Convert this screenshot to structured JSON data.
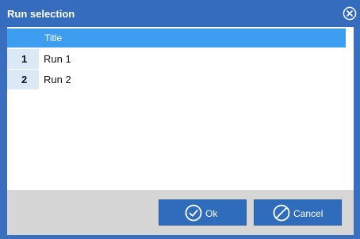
{
  "dialog": {
    "title": "Run selection"
  },
  "grid": {
    "columns": [
      "Title"
    ],
    "rows": [
      {
        "num": "1",
        "title": "Run 1"
      },
      {
        "num": "2",
        "title": "Run 2"
      }
    ]
  },
  "buttons": {
    "ok_label": "Ok",
    "cancel_label": "Cancel"
  },
  "icons": {
    "close": "close-circle-icon",
    "ok": "check-circle-icon",
    "cancel": "prohibit-circle-icon"
  },
  "colors": {
    "titlebar": "#356cbe",
    "grid_header": "#3d9ef0",
    "row_number_bg": "#dbe9f6",
    "button": "#2f6cbc",
    "footer": "#d6d6d6"
  }
}
